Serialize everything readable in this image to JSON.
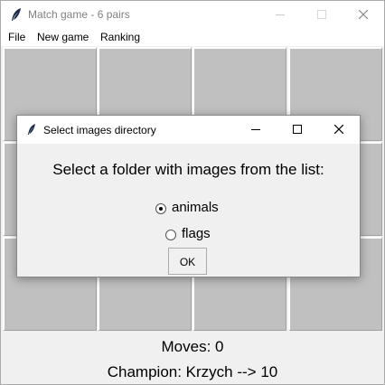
{
  "window": {
    "title": "Match game - 6 pairs"
  },
  "menu": [
    "File",
    "New game",
    "Ranking"
  ],
  "status": {
    "moves": "Moves: 0",
    "champion": "Champion: Krzych --> 10"
  },
  "dialog": {
    "title": "Select images directory",
    "prompt": "Select a folder with images from the list:",
    "options": [
      {
        "label": "animals",
        "selected": true
      },
      {
        "label": "flags",
        "selected": false
      }
    ],
    "ok_label": "OK"
  },
  "icons": {
    "app": "feather-icon",
    "minimize": "minimize-icon",
    "maximize": "maximize-icon",
    "close": "close-icon"
  }
}
